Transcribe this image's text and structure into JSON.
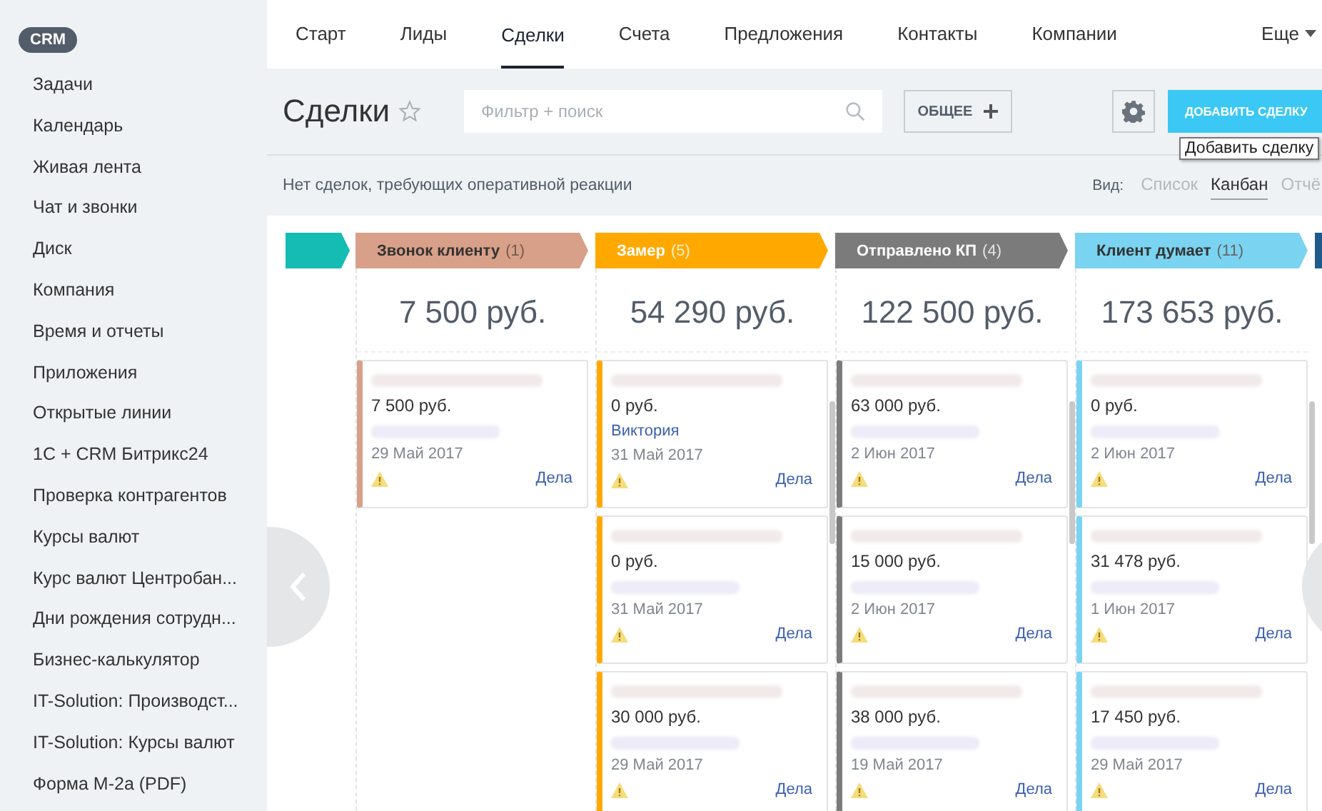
{
  "sidebar": {
    "badge": "CRM",
    "items": [
      {
        "label": "Задачи"
      },
      {
        "label": "Календарь"
      },
      {
        "label": "Живая лента"
      },
      {
        "label": "Чат и звонки"
      },
      {
        "label": "Диск"
      },
      {
        "label": "Компания"
      },
      {
        "label": "Время и отчеты"
      },
      {
        "label": "Приложения"
      },
      {
        "label": "Открытые линии"
      },
      {
        "label": "1С + CRM Битрикс24"
      },
      {
        "label": "Проверка контрагентов"
      },
      {
        "label": "Курсы валют"
      },
      {
        "label": "Курс валют Центробан..."
      },
      {
        "label": "Дни рождения сотрудн..."
      },
      {
        "label": "Бизнес-калькулятор"
      },
      {
        "label": "IT-Solution: Производст..."
      },
      {
        "label": "IT-Solution: Курсы валют"
      },
      {
        "label": "Форма М-2а (PDF)"
      }
    ]
  },
  "top_nav": {
    "items": [
      {
        "label": "Старт",
        "selected": false
      },
      {
        "label": "Лиды",
        "selected": false
      },
      {
        "label": "Сделки",
        "selected": true
      },
      {
        "label": "Счета",
        "selected": false
      },
      {
        "label": "Предложения",
        "selected": false
      },
      {
        "label": "Контакты",
        "selected": false
      },
      {
        "label": "Компании",
        "selected": false
      }
    ],
    "more": "Еще"
  },
  "toolbar": {
    "title": "Сделки",
    "favorite": false,
    "search": {
      "placeholder": "Фильтр + поиск"
    },
    "filter_button": "ОБЩЕЕ",
    "add_button": "ДОБАВИТЬ СДЕЛКУ",
    "tooltip": "Добавить сделку"
  },
  "notice": "Нет сделок, требующих оперативной реакции",
  "views": {
    "label": "Вид:",
    "items": [
      {
        "label": "Список",
        "selected": false
      },
      {
        "label": "Канбан",
        "selected": true
      },
      {
        "label": "Отчё",
        "selected": false
      }
    ]
  },
  "stages": [
    {
      "kind": "clipped",
      "color": "#14bcb4"
    },
    {
      "kind": "full",
      "name": "Звонок клиенту",
      "count": "(1)",
      "color": "#d8a088",
      "dark_text": true,
      "total": "7 500 руб.",
      "cards": [
        {
          "title_hidden": true,
          "amount": "7 500 руб.",
          "contact_hidden": true,
          "date": "29 Май 2017",
          "warning": true,
          "link": "Дела"
        }
      ]
    },
    {
      "kind": "full",
      "name": "Замер",
      "count": "(5)",
      "color": "#ffa900",
      "dark_text": false,
      "total": "54 290 руб.",
      "cards": [
        {
          "title_hidden": true,
          "amount": "0 руб.",
          "contact": "Виктория",
          "date": "31 Май 2017",
          "warning": true,
          "link": "Дела"
        },
        {
          "title_hidden": true,
          "amount": "0 руб.",
          "contact_hidden": true,
          "date": "31 Май 2017",
          "warning": true,
          "link": "Дела"
        },
        {
          "title_hidden": true,
          "amount": "30 000 руб.",
          "contact_hidden": true,
          "date": "29 Май 2017",
          "warning": true,
          "link": "Дела"
        }
      ]
    },
    {
      "kind": "full",
      "name": "Отправлено КП",
      "count": "(4)",
      "color": "#7b7b7b",
      "dark_text": false,
      "total": "122 500 руб.",
      "cards": [
        {
          "title_hidden": true,
          "amount": "63 000 руб.",
          "contact_hidden": true,
          "date": "2 Июн 2017",
          "warning": true,
          "link": "Дела"
        },
        {
          "title_hidden": true,
          "amount": "15 000 руб.",
          "contact_hidden": true,
          "date": "2 Июн 2017",
          "warning": true,
          "link": "Дела"
        },
        {
          "title_hidden": true,
          "amount": "38 000 руб.",
          "contact_hidden": true,
          "date": "19 Май 2017",
          "warning": true,
          "link": "Дела"
        }
      ]
    },
    {
      "kind": "full",
      "name": "Клиент думает",
      "count": "(11)",
      "color": "#7ad3f0",
      "dark_text": true,
      "total": "173 653 руб.",
      "cards": [
        {
          "title_hidden": true,
          "amount": "0 руб.",
          "contact_hidden": true,
          "date": "2 Июн 2017",
          "warning": true,
          "link": "Дела"
        },
        {
          "title_hidden": true,
          "amount": "31 478 руб.",
          "contact_hidden": true,
          "date": "1 Июн 2017",
          "warning": true,
          "link": "Дела"
        },
        {
          "title_hidden": true,
          "amount": "17 450 руб.",
          "contact_hidden": true,
          "date": "29 Май 2017",
          "warning": true,
          "link": "Дела"
        }
      ]
    },
    {
      "kind": "clipped",
      "color": "#1f5b8a"
    }
  ]
}
